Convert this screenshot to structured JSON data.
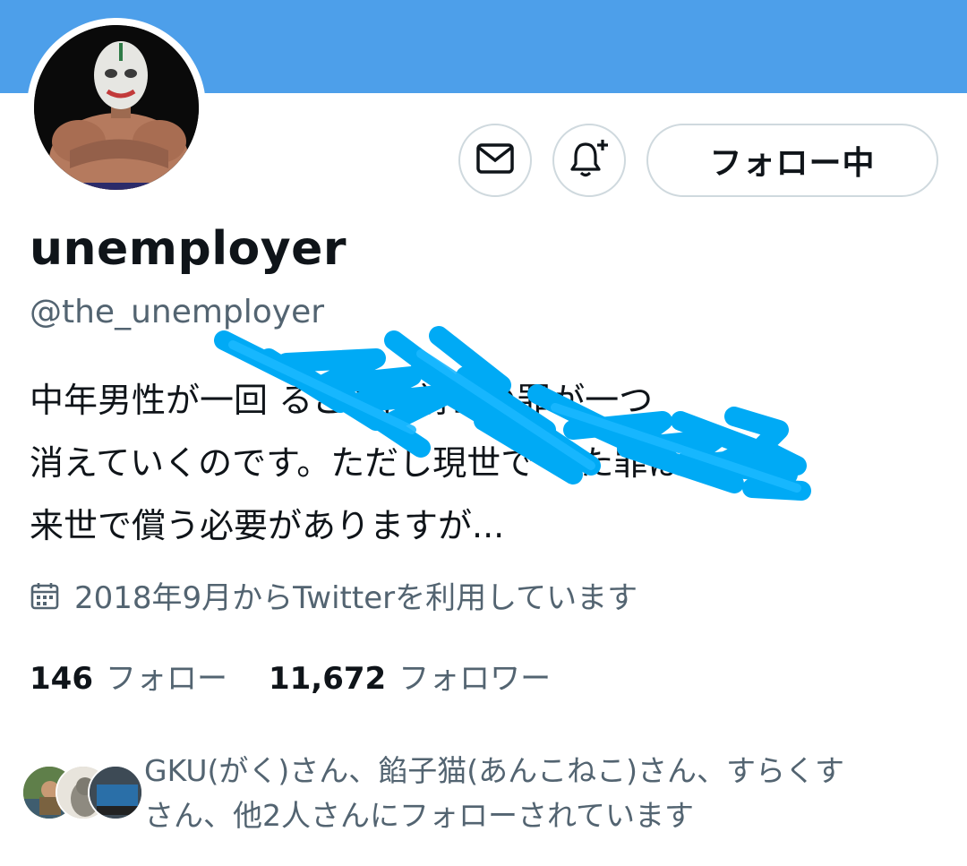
{
  "profile": {
    "display_name": "unemployer",
    "handle": "@the_unemployer",
    "bio_lines": [
      "中年男性が一回                るごとに前世の罪が一つ",
      "消えていくのです。ただし現世で                した罪は",
      "来世で償う必要がありますが..."
    ],
    "joined": "2018年9月からTwitterを利用しています"
  },
  "actions": {
    "message_icon": "mail-icon",
    "notify_icon": "bell-plus-icon",
    "follow_label": "フォロー中"
  },
  "stats": {
    "following_count": "146",
    "following_label": "フォロー",
    "followers_count": "11,672",
    "followers_label": "フォロワー"
  },
  "followed_by": {
    "lines": [
      "GKU(がく)さん、餡子猫(あんこねこ)さん、すらくす",
      "さん、他2人さんにフォローされています"
    ]
  },
  "colors": {
    "banner": "#4d9fea",
    "scribble": "#00aaf5",
    "secondary_text": "#536471",
    "border": "#cfd9de"
  }
}
